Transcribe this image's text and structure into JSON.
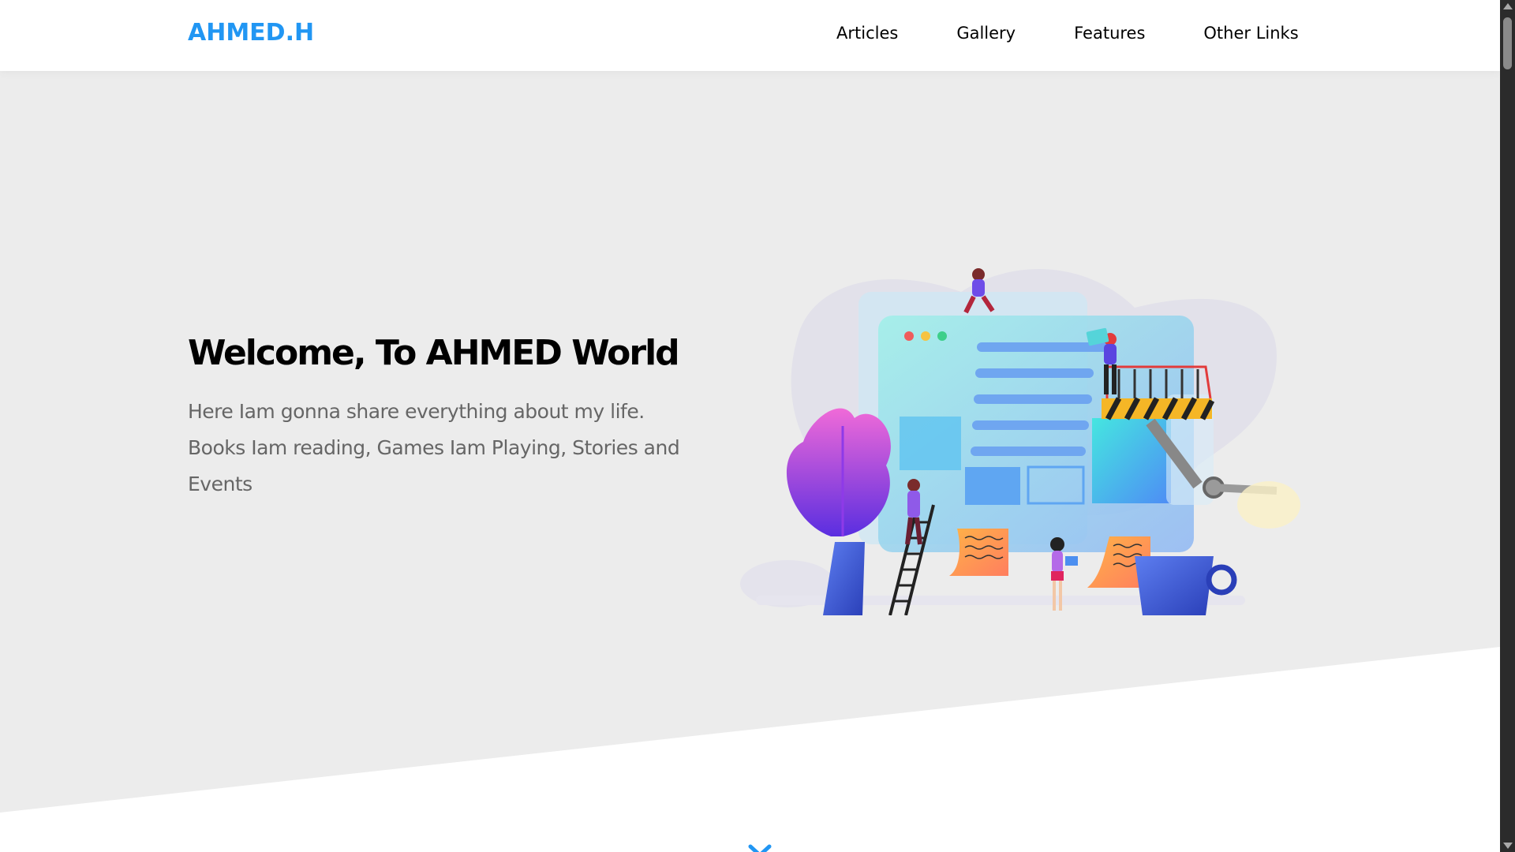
{
  "header": {
    "logo": "AHMED.H",
    "nav": [
      {
        "label": "Articles"
      },
      {
        "label": "Gallery"
      },
      {
        "label": "Features"
      },
      {
        "label": "Other Links"
      }
    ]
  },
  "landing": {
    "title": "Welcome, To AHMED World",
    "description": "Here Iam gonna share everything about my life. Books Iam reading, Games Iam Playing, Stories and Events"
  },
  "icons": {
    "go_down": "double-chevron-down-icon"
  },
  "colors": {
    "accent": "#2196f3",
    "landing_bg": "#ececec",
    "text": "#000000",
    "muted": "#666666"
  }
}
